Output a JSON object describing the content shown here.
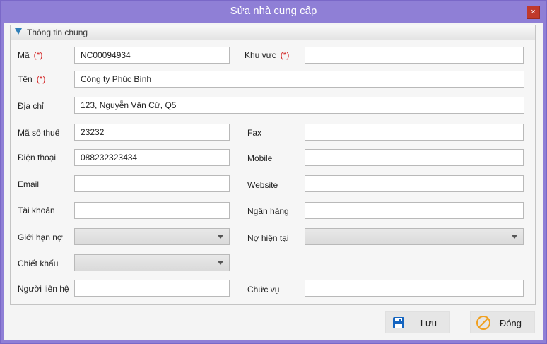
{
  "window": {
    "title": "Sửa nhà cung cấp",
    "close_glyph": "×"
  },
  "group": {
    "title": "Thông tin chung"
  },
  "form": {
    "required_marker": "(*)",
    "ma": {
      "label": "Mã",
      "value": "NC00094934"
    },
    "khu_vuc": {
      "label": "Khu vực",
      "value": ""
    },
    "ten": {
      "label": "Tên",
      "value": "Công ty Phúc Bình"
    },
    "dia_chi": {
      "label": "Địa chỉ",
      "value": "123, Nguyễn Văn Cừ, Q5"
    },
    "ma_so_thue": {
      "label": "Mã số thuế",
      "value": "23232"
    },
    "fax": {
      "label": "Fax",
      "value": ""
    },
    "dien_thoai": {
      "label": "Điện thoại",
      "value": "088232323434"
    },
    "mobile": {
      "label": "Mobile",
      "value": ""
    },
    "email": {
      "label": "Email",
      "value": ""
    },
    "website": {
      "label": "Website",
      "value": ""
    },
    "tai_khoan": {
      "label": "Tài khoản",
      "value": ""
    },
    "ngan_hang": {
      "label": "Ngân hàng",
      "value": ""
    },
    "gioi_han_no": {
      "label": "Giới hạn nợ",
      "value": ""
    },
    "no_hien_tai": {
      "label": "Nợ hiện tại",
      "value": ""
    },
    "chiet_khau": {
      "label": "Chiết khấu",
      "value": ""
    },
    "nguoi_lien_he": {
      "label": "Người liên hệ",
      "value": ""
    },
    "chuc_vu": {
      "label": "Chức vụ",
      "value": ""
    }
  },
  "buttons": {
    "save": {
      "label": "Lưu",
      "icon": "save-icon"
    },
    "close": {
      "label": "Đóng",
      "icon": "ban-icon"
    }
  },
  "colors": {
    "title_bar": "#8f7fd6",
    "close_button": "#c0392b",
    "required": "#d21b1b",
    "save_icon": "#1565c0",
    "close_icon": "#f0a020"
  }
}
